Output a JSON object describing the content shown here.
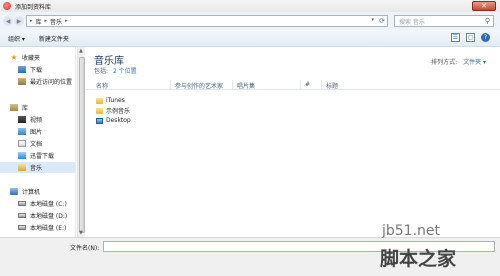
{
  "window": {
    "title": "添加到资料库",
    "close_glyph": "✕"
  },
  "address": {
    "crumbs": [
      "库",
      "音乐"
    ],
    "search_placeholder": "搜索 音乐"
  },
  "toolbar": {
    "organize_label": "组织 ▾",
    "new_folder_label": "新建文件夹"
  },
  "sidebar": {
    "items": [
      {
        "label": "收藏夹",
        "icon": "star-icon"
      },
      {
        "label": "下载",
        "icon": "download-folder-icon"
      },
      {
        "label": "最近访问的位置",
        "icon": "recent-places-icon"
      },
      {
        "label": "库",
        "icon": "library-icon"
      },
      {
        "label": "视频",
        "icon": "video-icon"
      },
      {
        "label": "图片",
        "icon": "picture-icon"
      },
      {
        "label": "文档",
        "icon": "document-icon"
      },
      {
        "label": "迅雷下载",
        "icon": "thunder-icon"
      },
      {
        "label": "音乐",
        "icon": "music-icon",
        "selected": true
      },
      {
        "label": "计算机",
        "icon": "computer-icon"
      },
      {
        "label": "本地磁盘 (C:)",
        "icon": "disk-icon"
      },
      {
        "label": "本地磁盘 (D:)",
        "icon": "disk-icon"
      },
      {
        "label": "本地磁盘 (E:)",
        "icon": "disk-icon"
      }
    ]
  },
  "library": {
    "title": "音乐库",
    "includes_label": "包括:",
    "includes_link": "2 个位置",
    "arrange_label": "排列方式:",
    "arrange_value": "文件夹 ▾"
  },
  "columns": [
    "名称",
    "参与创作的艺术家",
    "唱片集",
    "#",
    "标题"
  ],
  "files": [
    {
      "name": "iTunes",
      "icon": "folder-icon"
    },
    {
      "name": "示例音乐",
      "icon": "folder-icon"
    },
    {
      "name": "Desktop",
      "icon": "desktop-icon"
    }
  ],
  "filename": {
    "label": "文件名(N):",
    "value": ""
  },
  "watermark": {
    "site": "jb51.net",
    "name": "脚本之家"
  }
}
